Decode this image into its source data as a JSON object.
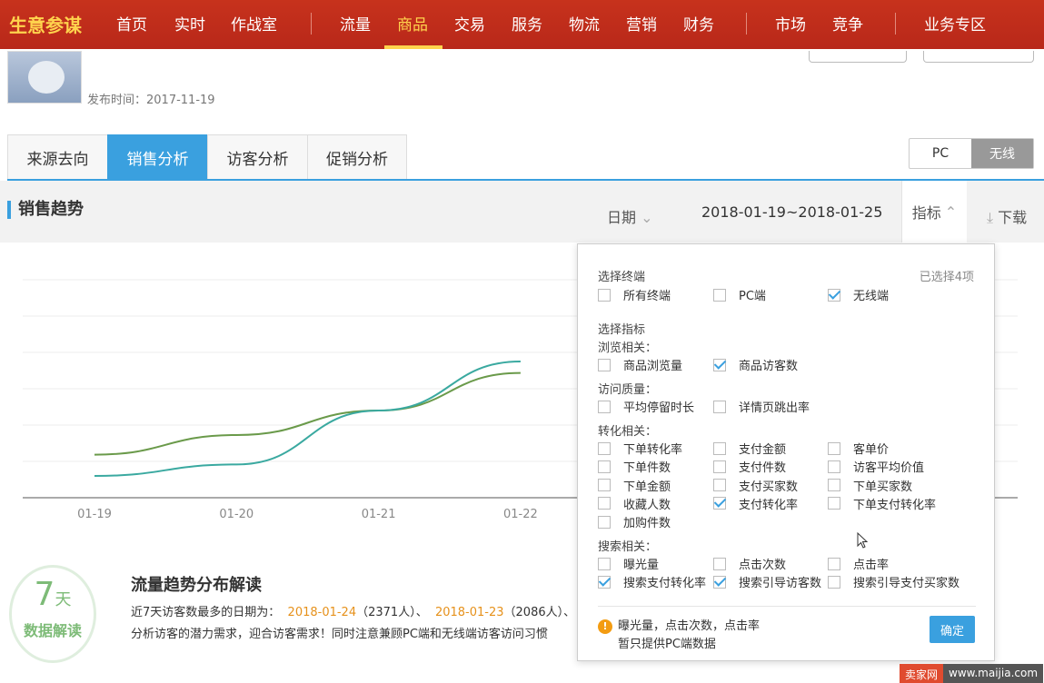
{
  "header": {
    "brand": "生意参谋",
    "nav": [
      "首页",
      "实时",
      "作战室",
      "流量",
      "商品",
      "交易",
      "服务",
      "物流",
      "营销",
      "财务",
      "市场",
      "竞争",
      "业务专区"
    ],
    "active": "商品"
  },
  "product": {
    "publish_date": "发布时间：2017-11-19"
  },
  "tabs": [
    "来源去向",
    "销售分析",
    "访客分析",
    "促销分析"
  ],
  "active_tab": "销售分析",
  "device_toggle": {
    "pc": "PC",
    "wireless": "无线",
    "selected": "无线"
  },
  "section": {
    "title": "销售趋势",
    "date_label": "日期",
    "date_range": "2018-01-19~2018-01-25",
    "indicator_label": "指标",
    "download_label": "下载"
  },
  "chart_data": {
    "type": "line",
    "x": [
      "01-19",
      "01-20",
      "01-21",
      "01-22"
    ],
    "series": [
      {
        "color": "#6a9a4a",
        "values": [
          0.18,
          0.3,
          0.45,
          0.68
        ]
      },
      {
        "color": "#3aa9a0",
        "values": [
          0.05,
          0.12,
          0.45,
          0.75
        ]
      }
    ]
  },
  "readout": {
    "badge_num": "7",
    "badge_unit": "天",
    "badge_text": "数据解读",
    "title": "流量趋势分布解读",
    "line1_a": "近7天访客数最多的日期为：",
    "date1": "2018-01-24",
    "count1": "（2371人）、",
    "date2": "2018-01-23",
    "count2": "（2086人）、",
    "line2": "分析访客的潜力需求，迎合访客需求！同时注意兼顾PC端和无线端访客访问习惯"
  },
  "popup": {
    "terminal_title": "选择终端",
    "selected_count": "已选择4项",
    "terminals": [
      {
        "label": "所有终端",
        "checked": false
      },
      {
        "label": "PC端",
        "checked": false
      },
      {
        "label": "无线端",
        "checked": true
      }
    ],
    "indicator_title": "选择指标",
    "browse_title": "浏览相关：",
    "browse": [
      {
        "label": "商品浏览量",
        "checked": false
      },
      {
        "label": "商品访客数",
        "checked": true
      }
    ],
    "quality_title": "访问质量：",
    "quality": [
      {
        "label": "平均停留时长",
        "checked": false
      },
      {
        "label": "详情页跳出率",
        "checked": false
      }
    ],
    "conversion_title": "转化相关：",
    "conversion": [
      {
        "label": "下单转化率",
        "checked": false
      },
      {
        "label": "支付金额",
        "checked": false
      },
      {
        "label": "客单价",
        "checked": false
      },
      {
        "label": "下单件数",
        "checked": false
      },
      {
        "label": "支付件数",
        "checked": false
      },
      {
        "label": "访客平均价值",
        "checked": false
      },
      {
        "label": "下单金额",
        "checked": false
      },
      {
        "label": "支付买家数",
        "checked": false
      },
      {
        "label": "下单买家数",
        "checked": false
      },
      {
        "label": "收藏人数",
        "checked": false
      },
      {
        "label": "支付转化率",
        "checked": true
      },
      {
        "label": "下单支付转化率",
        "checked": false
      },
      {
        "label": "加购件数",
        "checked": false
      }
    ],
    "search_title": "搜索相关：",
    "search": [
      {
        "label": "曝光量",
        "checked": false
      },
      {
        "label": "点击次数",
        "checked": false
      },
      {
        "label": "点击率",
        "checked": false
      },
      {
        "label": "搜索支付转化率",
        "checked": true
      },
      {
        "label": "搜索引导访客数",
        "checked": true
      },
      {
        "label": "搜索引导支付买家数",
        "checked": false
      }
    ],
    "notice_line1": "曝光量，点击次数，点击率",
    "notice_line2": "暂只提供PC端数据",
    "confirm": "确定"
  },
  "watermark": {
    "left": "卖家网",
    "right": "www.maijia.com"
  }
}
